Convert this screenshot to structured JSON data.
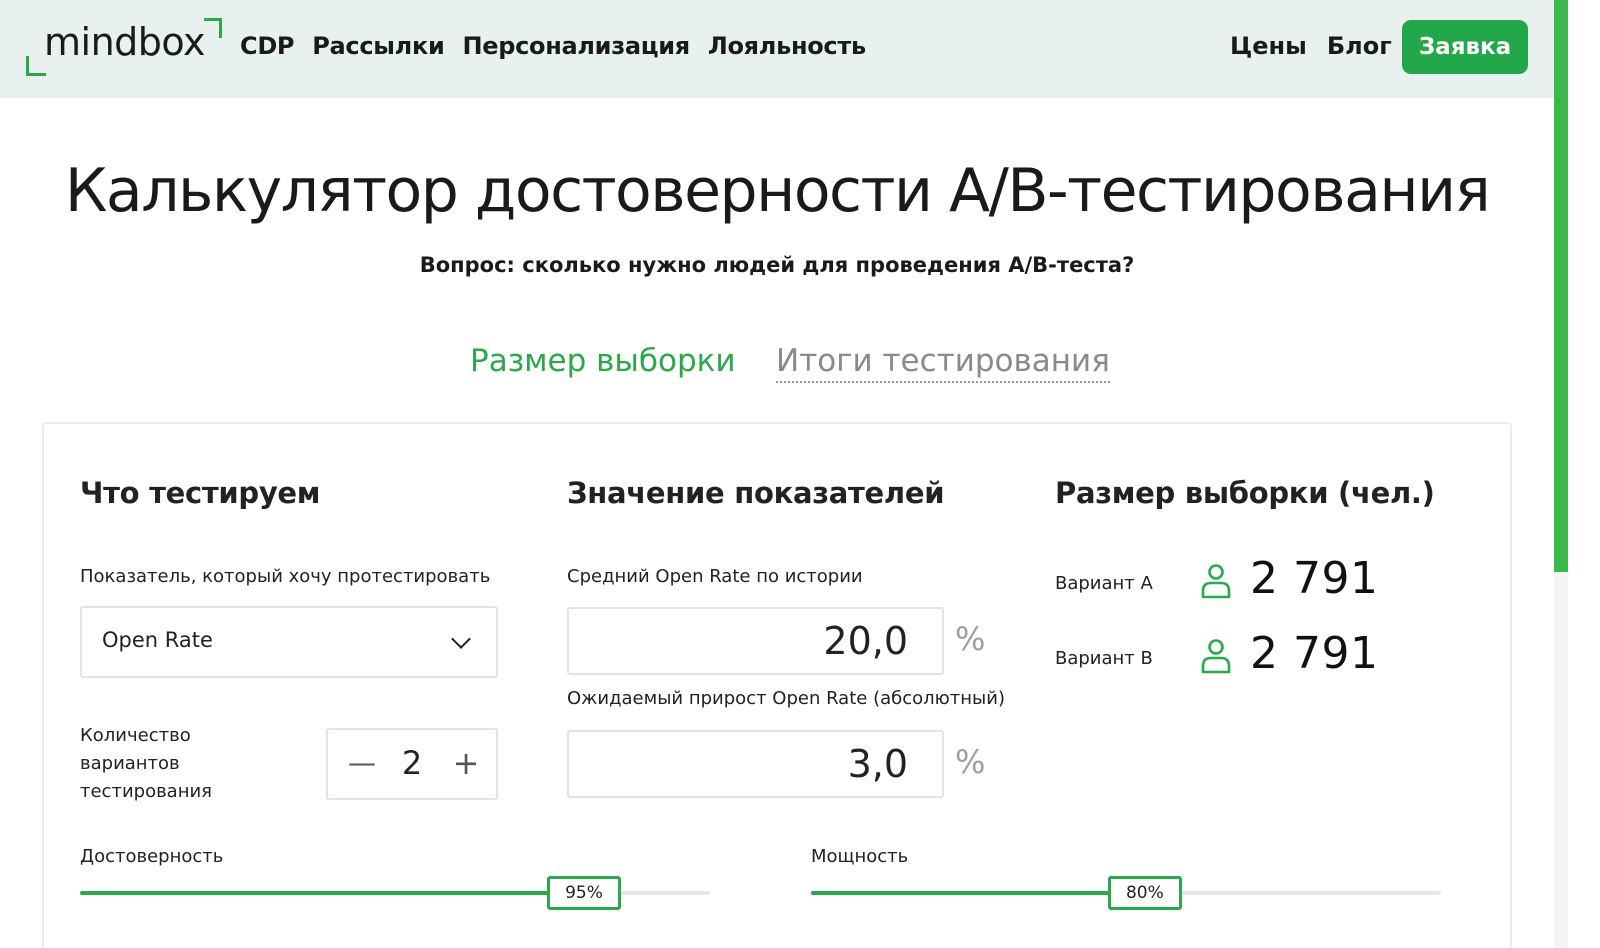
{
  "header": {
    "logo_text": "mindbox",
    "nav": [
      "CDP",
      "Рассылки",
      "Персонализация",
      "Лояльность"
    ],
    "nav_right": [
      "Цены",
      "Блог"
    ],
    "cta_label": "Заявка",
    "accent_color": "#22a84a"
  },
  "page": {
    "title": "Калькулятор достоверности А/В-тестирования",
    "subtitle": "Вопрос: сколько нужно людей для проведения А/В-теста?"
  },
  "tabs": [
    {
      "label": "Размер выборки",
      "active": true
    },
    {
      "label": "Итоги тестирования",
      "active": false
    }
  ],
  "what_testing": {
    "heading": "Что тестируем",
    "metric_label": "Показатель, который хочу протестировать",
    "metric_value": "Open Rate",
    "variants_label": "Количество вариантов тестирования",
    "variants_count": "2",
    "minus": "—",
    "plus": "+"
  },
  "values": {
    "heading": "Значение показателей",
    "avg_label": "Средний Open Rate по истории",
    "avg_value": "20,0",
    "lift_label": "Ожидаемый прирост Open Rate (абсолютный)",
    "lift_value": "3,0",
    "unit": "%"
  },
  "sample": {
    "heading": "Размер выборки (чел.)",
    "variants": [
      {
        "label": "Вариант A",
        "value": "2 791",
        "icon": "person-icon"
      },
      {
        "label": "Вариант B",
        "value": "2 791",
        "icon": "person-icon"
      }
    ]
  },
  "sliders": {
    "confidence": {
      "label": "Достоверность",
      "value_text": "95%",
      "fraction": 0.8
    },
    "power": {
      "label": "Мощность",
      "value_text": "80%",
      "fraction": 0.53
    }
  }
}
